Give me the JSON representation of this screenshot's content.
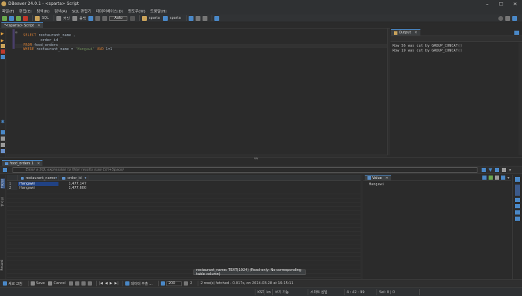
{
  "window": {
    "title": "DBeaver 24.0.1 - <sparta> Script"
  },
  "menu": [
    "파일(F)",
    "편집(E)",
    "탐색(N)",
    "검색(A)",
    "SQL 편집기",
    "데이터베이스(D)",
    "윈도우(W)",
    "도움말(H)"
  ],
  "toolbar": {
    "sql_label": "SQL",
    "commit_label": "커밋",
    "rollback_label": "롤백",
    "transaction_mode": "Auto",
    "datasource": "sparta",
    "schema": "sparta"
  },
  "editor": {
    "tab_label": "*<sparta> Script",
    "lines": [
      [
        [
          "kw",
          "SELECT"
        ],
        [
          "id",
          " restaurant_name ,"
        ]
      ],
      [
        [
          "id",
          "        order_id"
        ]
      ],
      [
        [
          "kw",
          "FROM"
        ],
        [
          "id",
          " food_orders"
        ]
      ],
      [
        [
          "kw",
          "WHERE"
        ],
        [
          "id",
          " restaurant_name = "
        ],
        [
          "str",
          "'Hangawi'"
        ],
        [
          "kw",
          " AND "
        ],
        [
          "id",
          "1=1"
        ]
      ]
    ]
  },
  "output": {
    "tab_label": "Output",
    "lines": [
      "Row 56 was cut by GROUP_CONCAT()",
      "Row 19 was cut by GROUP_CONCAT()"
    ]
  },
  "results": {
    "tab_label": "food_orders 1",
    "filter_placeholder": "Enter a SQL expression to filter results (use Ctrl+Space)",
    "side_labels": {
      "grid": "그리드",
      "text": "텍스트",
      "record": "Record"
    },
    "columns": [
      "restaurant_name",
      "order_id"
    ],
    "rows": [
      {
        "num": "1",
        "restaurant_name": "Hangawi",
        "order_id": "1,477,147"
      },
      {
        "num": "2",
        "restaurant_name": "Hangawi",
        "order_id": "1,477,600"
      }
    ],
    "tooltip": "restaurant_name: TEXT(1024) (Read-only: No corresponding table column)"
  },
  "value_panel": {
    "tab_label": "Value",
    "value": "Hangawi"
  },
  "bottom_toolbar": {
    "refresh_label": "새로 고침",
    "save_label": "Save",
    "cancel_label": "Cancel",
    "export_label": "데이터 추출 ...",
    "fetch_size": "200",
    "row_count": "2",
    "status_message": "2 row(s) fetched - 0.017s, on 2024-03-28 at 16:15:11"
  },
  "statusbar": {
    "timezone": "KST",
    "locale": "ko",
    "writable": "쓰기 가능",
    "insert_mode": "스마트 삽입",
    "position": "4 : 42 : 99",
    "selection": "Sel: 0 | 0"
  },
  "colors": {
    "accent": "#4a88c7",
    "selection": "#214283",
    "keyword": "#cc7832",
    "string": "#6a8759"
  }
}
